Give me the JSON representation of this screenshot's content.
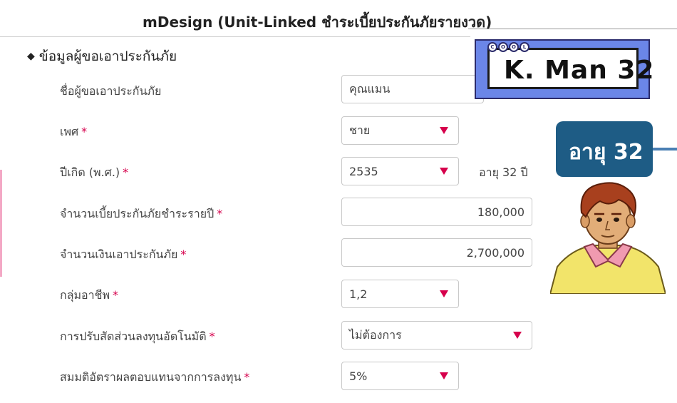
{
  "header": {
    "title": "mDesign (Unit-Linked ชำระเบี้ยประกันภัยรายงวด)"
  },
  "section": {
    "bullet": "◆",
    "title": "ข้อมูลผู้ขอเอาประกันภัย"
  },
  "required_mark": "*",
  "form": {
    "name_label": "ชื่อผู้ขอเอาประกันภัย",
    "name_value": "คุณแมน",
    "gender_label": "เพศ",
    "gender_value": "ชาย",
    "birth_year_label": "ปีเกิด (พ.ศ.)",
    "birth_year_value": "2535",
    "age_text": "อายุ 32 ปี",
    "premium_label": "จำนวนเบี้ยประกันภัยชำระรายปี",
    "premium_value": "180,000",
    "sum_insured_label": "จำนวนเงินเอาประกันภัย",
    "sum_insured_value": "2,700,000",
    "occupation_label": "กลุ่มอาชีพ",
    "occupation_value": "1,2",
    "rebalance_label": "การปรับสัดส่วนลงทุนอัตโนมัติ",
    "rebalance_value": "ไม่ต้องการ",
    "return_rate_label": "สมมติอัตราผลตอบแทนจากการลงทุน",
    "return_rate_value": "5%"
  },
  "overlay": {
    "badge_letters": [
      "C",
      "O",
      "O",
      "L"
    ],
    "name_card": "K. Man 32",
    "age_badge": "อายุ 32"
  },
  "colors": {
    "accent": "#d6004c",
    "name_card_bg": "#6b86e8",
    "age_badge_bg": "#1e5c85"
  }
}
